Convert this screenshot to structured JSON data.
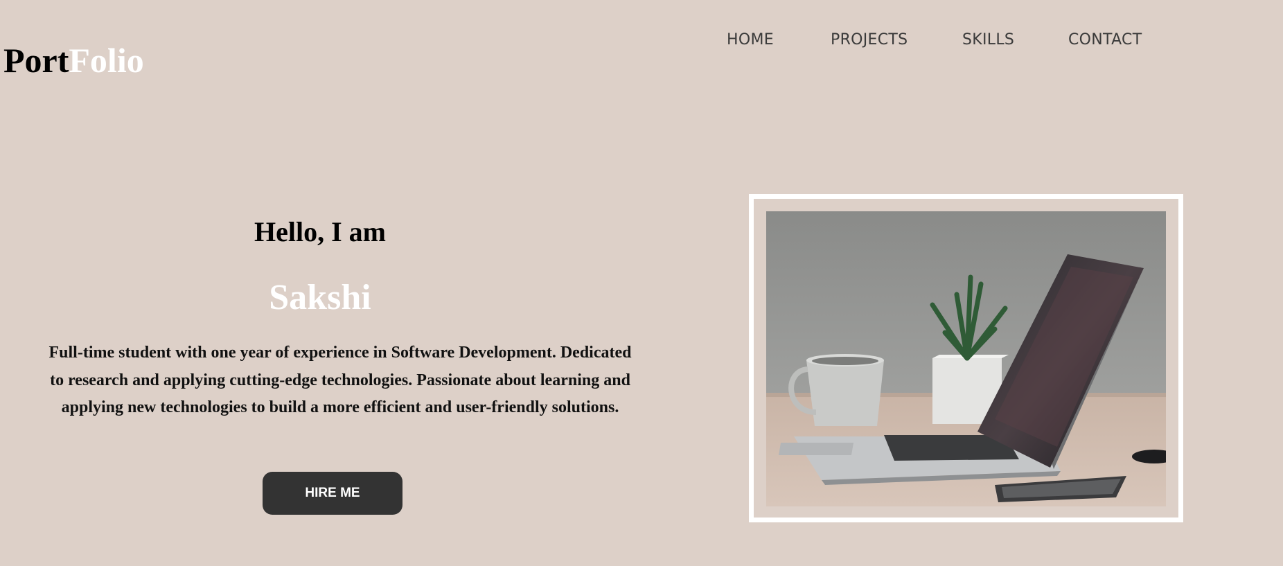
{
  "brand": {
    "part1": "Port",
    "part2": "Folio"
  },
  "nav": {
    "items": [
      "HOME",
      "PROJECTS",
      "SKILLS",
      "CONTACT"
    ]
  },
  "hero": {
    "greeting": "Hello, I am",
    "name": "Sakshi",
    "bio": "Full-time student with one year of experience in Software Development. Dedicated to research and applying cutting-edge technologies. Passionate about learning and applying new technologies to build a more efficient and user-friendly solutions.",
    "cta_label": "HIRE ME"
  },
  "colors": {
    "background": "#ddd0c8",
    "accent_white": "#ffffff",
    "button_bg": "#333333"
  },
  "image": {
    "subject": "laptop-desk-photo"
  }
}
